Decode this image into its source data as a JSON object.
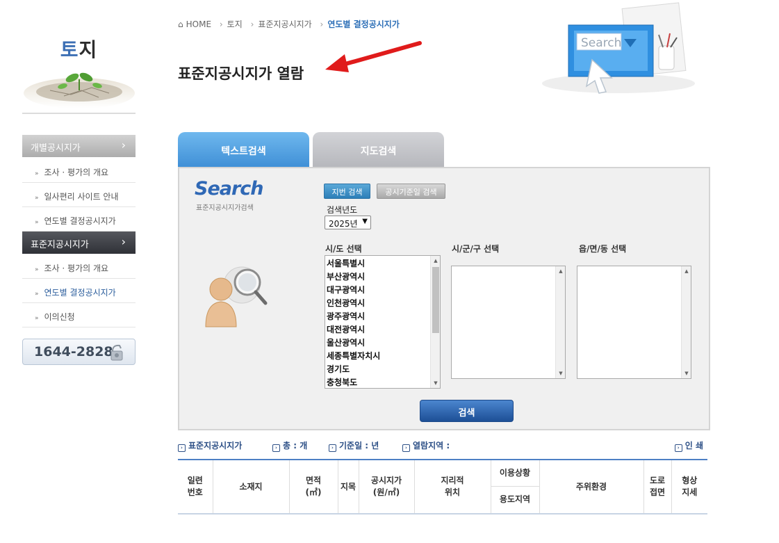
{
  "colors": {
    "accent": "#2d6fb7",
    "tab_active": "#4d9ce0",
    "tab_inactive": "#c3c4c8",
    "menu_dark": "#3a3c42"
  },
  "sidebar": {
    "title_part1": "토",
    "title_part2": "지",
    "section1": {
      "label": "개별공시지가",
      "chevron": "›"
    },
    "section1_items": [
      {
        "label": "조사 · 평가의 개요"
      },
      {
        "label": "일사편리 사이트 안내"
      },
      {
        "label": "연도별 결정공시지가"
      }
    ],
    "section2": {
      "label": "표준지공시지가",
      "chevron": "›"
    },
    "section2_items": [
      {
        "label": "조사 · 평가의 개요"
      },
      {
        "label": "연도별 결정공시지가"
      },
      {
        "label": "이의신청"
      }
    ],
    "phone": "1644-2828",
    "bullet": "»"
  },
  "breadcrumb": {
    "home": "HOME",
    "items": [
      "토지",
      "표준지공시지가",
      "연도별 결정공시지가"
    ],
    "separator": "›"
  },
  "page_title": "표준지공시지가 열람",
  "banner": {
    "search_text": "Search"
  },
  "tabs": [
    {
      "label": "텍스트검색",
      "active": true
    },
    {
      "label": "지도검색",
      "active": false
    }
  ],
  "search_panel": {
    "logo": "Search",
    "logo_sub": "표준지공시지가검색",
    "btn_jibun": "지번 검색",
    "btn_date": "공시기준일 검색",
    "year_label": "검색년도",
    "year_value": "2025년",
    "col_sido": "시/도 선택",
    "col_sigungu": "시/군/구 선택",
    "col_eupmyeondong": "읍/면/동 선택",
    "sido_options": [
      "서울특별시",
      "부산광역시",
      "대구광역시",
      "인천광역시",
      "광주광역시",
      "대전광역시",
      "울산광역시",
      "세종특별자치시",
      "경기도",
      "충청북도"
    ],
    "search_button": "검색"
  },
  "summary": {
    "title": "표준지공시지가",
    "total": "총 : 개",
    "base_date": "기준일 : 년",
    "region": "열람지역 :",
    "print": "인 쇄",
    "icon": "›"
  },
  "table_headers": {
    "serial_1": "일련",
    "serial_2": "번호",
    "address": "소재지",
    "area_1": "면적",
    "area_2": "(㎡)",
    "jimok": "지목",
    "price_1": "공시지가",
    "price_2": "(원/㎡)",
    "geo_1": "지리적",
    "geo_2": "위치",
    "usage": "이용상황",
    "zone": "용도지역",
    "surroundings": "주위환경",
    "road_1": "도로",
    "road_2": "접면",
    "shape_1": "형상",
    "shape_2": "지세"
  }
}
